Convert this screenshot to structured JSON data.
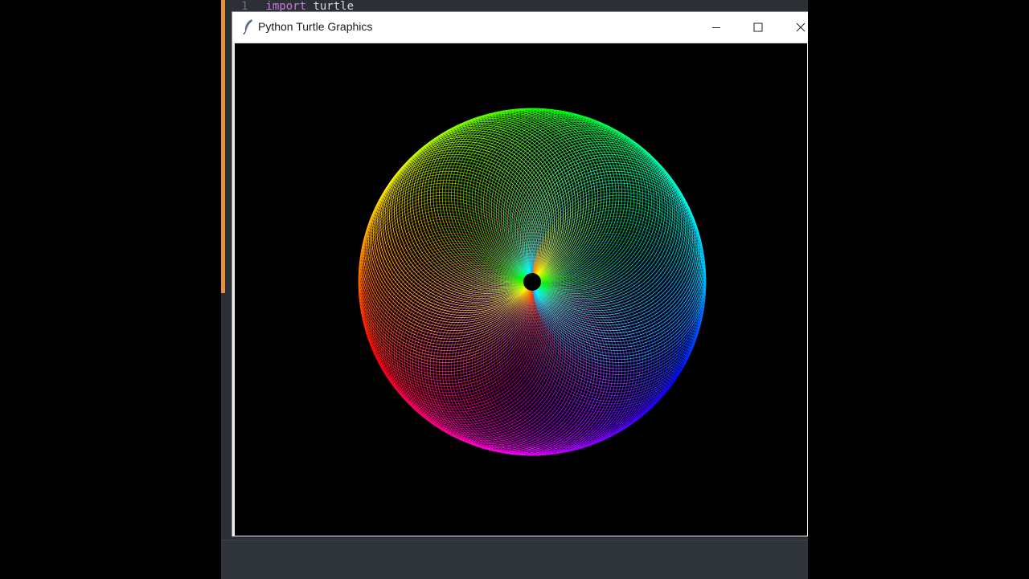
{
  "editor": {
    "line_number": "1",
    "keyword": "import",
    "module": "turtle"
  },
  "window": {
    "title": "Python Turtle Graphics",
    "icon": "feather-icon",
    "controls": [
      "minimize-icon",
      "maximize-icon",
      "close-icon"
    ]
  },
  "canvas": {
    "background": "#000000",
    "drawing": "spirograph-rainbow-circles",
    "turtle_color": "#000000"
  }
}
